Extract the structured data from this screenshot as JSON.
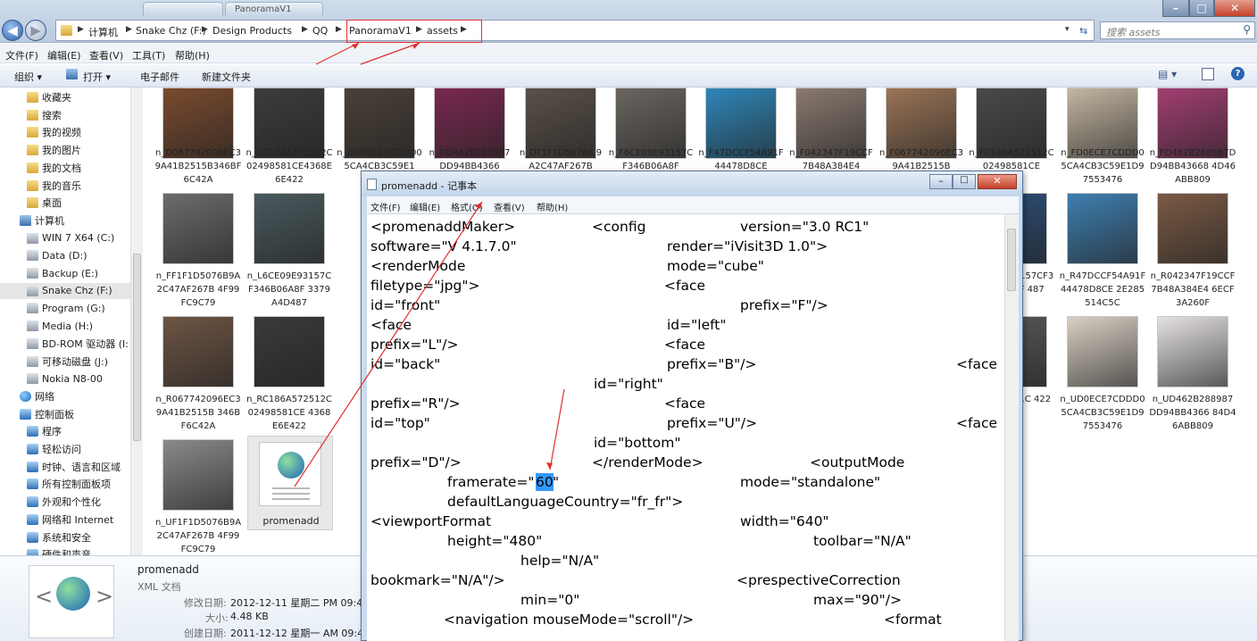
{
  "window": {
    "tabs": [
      "",
      "PanoramaV1"
    ],
    "controls": {
      "minimize": "–",
      "maximize": "□",
      "close": "✕"
    }
  },
  "address": {
    "crumbs": [
      "计算机",
      "Snake Chz (F:)",
      "Design Products",
      "QQ",
      "PanoramaV1",
      "assets"
    ],
    "search_placeholder": "搜索 assets"
  },
  "menu": [
    "文件(F)",
    "编辑(E)",
    "查看(V)",
    "工具(T)",
    "帮助(H)"
  ],
  "toolbar": {
    "organize": "组织 ▾",
    "open": "打开 ▾",
    "email": "电子邮件",
    "new_folder": "新建文件夹"
  },
  "sidebar": {
    "items": [
      {
        "label": "收藏夹",
        "icon": "folder-icon"
      },
      {
        "label": "搜索",
        "icon": "folder-icon"
      },
      {
        "label": "我的视频",
        "icon": "folder-icon"
      },
      {
        "label": "我的图片",
        "icon": "folder-icon"
      },
      {
        "label": "我的文档",
        "icon": "folder-icon"
      },
      {
        "label": "我的音乐",
        "icon": "folder-icon"
      },
      {
        "label": "桌面",
        "icon": "folder-icon"
      },
      {
        "label": "计算机",
        "icon": "computer-icon"
      },
      {
        "label": "WIN 7 X64 (C:)",
        "icon": "drive-icon"
      },
      {
        "label": "Data (D:)",
        "icon": "drive-icon"
      },
      {
        "label": "Backup (E:)",
        "icon": "drive-icon"
      },
      {
        "label": "Snake Chz (F:)",
        "icon": "drive-icon"
      },
      {
        "label": "Program (G:)",
        "icon": "drive-icon"
      },
      {
        "label": "Media (H:)",
        "icon": "drive-icon"
      },
      {
        "label": "BD-ROM 驱动器 (I:",
        "icon": "drive-icon"
      },
      {
        "label": "可移动磁盘 (J:)",
        "icon": "drive-icon"
      },
      {
        "label": "Nokia N8-00",
        "icon": "drive-icon"
      },
      {
        "label": "网络",
        "icon": "globe-icon"
      },
      {
        "label": "控制面板",
        "icon": "panel-icon"
      },
      {
        "label": "程序",
        "icon": "panel-icon"
      },
      {
        "label": "轻松访问",
        "icon": "panel-icon"
      },
      {
        "label": "时钟、语言和区域",
        "icon": "panel-icon"
      },
      {
        "label": "所有控制面板项",
        "icon": "panel-icon"
      },
      {
        "label": "外观和个性化",
        "icon": "panel-icon"
      },
      {
        "label": "网络和 Internet",
        "icon": "panel-icon"
      },
      {
        "label": "系统和安全",
        "icon": "panel-icon"
      },
      {
        "label": "硬件和声音",
        "icon": "panel-icon"
      }
    ]
  },
  "files": {
    "row1": [
      {
        "name": "n_D067742096EC39A41B2515B346BF6C42A",
        "color": "#7a4a2e"
      },
      {
        "name": "n_DC186A572512C02498581CE4368E6E422",
        "color": "#3c3c3c"
      },
      {
        "name": "n_DD0ECE7CDDD05CA4CB3C59E1",
        "color": "#4a4038"
      },
      {
        "name": "n_DD462B288987DD94BB4366",
        "color": "#7a2850"
      },
      {
        "name": "n_DF1F1D50768 9A2C47AF267B",
        "color": "#5a5048"
      },
      {
        "name": "n_F6CE09E93157CF346B06A8F",
        "color": "#6a6560"
      },
      {
        "name": "n_F47DCCF54A91F44478D8CE",
        "color": "#2f86b8"
      },
      {
        "name": "n_F042347F19CCF7B48A384E4",
        "color": "#8a7a70"
      },
      {
        "name": "n_F067742096EC39A41B2515B",
        "color": "#9a7456"
      },
      {
        "name": "n_FC186A572512C02498581CE",
        "color": "#4a4a4a"
      },
      {
        "name": "n_FD0ECE7CDDD05CA4CB3C59E1D97553476",
        "color": "#c3b6a2"
      },
      {
        "name": "n_FD462B288987DD94BB43668 4D46ABB809",
        "color": "#a23e72"
      }
    ],
    "row2": [
      {
        "name": "n_FF1F1D5076B9A2C47AF267B 4F99FC9C79",
        "color": "#6c6c6c"
      },
      {
        "name": "n_L6CE09E93157CF346B06A8F 3379A4D487",
        "color": "#4a5a5e"
      },
      {
        "name": "n_RE09E93157CF346B06A8F 487",
        "color": "#2d4f7a"
      },
      {
        "name": "n_R47DCCF54A91F44478D8CE 2E285514C5C",
        "color": "#3e7fb0"
      },
      {
        "name": "n_R042347F19CCF7B48A384E4 6ECF3A260F",
        "color": "#7a5a44"
      }
    ],
    "row3": [
      {
        "name": "n_R067742096EC39A41B2515B 346BF6C42A",
        "color": "#6e5544"
      },
      {
        "name": "n_RC186A572512C02498581CE 4368E6E422",
        "color": "#3a3a3a"
      },
      {
        "name": "n_5725 581C 422",
        "color": "#5a5a5a"
      },
      {
        "name": "n_UD0ECE7CDDD05CA4CB3C59E1D97553476",
        "color": "#d9d0c4"
      },
      {
        "name": "n_UD462B288987DD94BB4366 84D46ABB809",
        "color": "#e6e2e2"
      }
    ],
    "row4": [
      {
        "name": "n_UF1F1D5076B9A2C47AF267B 4F99FC9C79",
        "color": "#8a8a8a"
      },
      {
        "name": "promenadd",
        "color": "#ffffff"
      }
    ]
  },
  "details": {
    "name": "promenadd",
    "type": "XML 文档",
    "modified_label": "修改日期:",
    "modified": "2012-12-11 星期二 PM 09:4",
    "size_label": "大小:",
    "size": "4.48 KB",
    "created_label": "创建日期:",
    "created": "2011-12-12 星期一 AM 09:4"
  },
  "notepad": {
    "title": "promenadd - 记事本",
    "menu": [
      "文件(F)",
      "编辑(E)",
      "格式(O)",
      "查看(V)",
      "帮助(H)"
    ],
    "lines": [
      [
        "<promenaddMaker>",
        "<config",
        "version=\"3.0 RC1\""
      ],
      [
        "software=\"V 4.1.7.0\"",
        "render=\"iVisit3D 1.0\">"
      ],
      [
        "<renderMode",
        "mode=\"cube\""
      ],
      [
        "filetype=\"jpg\">",
        "<face"
      ],
      [
        "id=\"front\"",
        "prefix=\"F\"/>"
      ],
      [
        "<face",
        "id=\"left\""
      ],
      [
        "prefix=\"L\"/>",
        "<face"
      ],
      [
        "id=\"back\"",
        "prefix=\"B\"/>",
        "<face"
      ],
      [
        "id=\"right\""
      ],
      [
        "prefix=\"R\"/>",
        "<face"
      ],
      [
        "id=\"top\"",
        "prefix=\"U\"/>",
        "<face"
      ],
      [
        "id=\"bottom\""
      ],
      [
        "prefix=\"D\"/>",
        "</renderMode>",
        "<outputMode"
      ],
      [
        "framerate=\"",
        "60",
        "\"",
        "mode=\"standalone\""
      ],
      [
        "defaultLanguageCountry=\"fr_fr\">"
      ],
      [
        "<viewportFormat",
        "width=\"640\""
      ],
      [
        "height=\"480\"",
        "toolbar=\"N/A\""
      ],
      [
        "help=\"N/A\""
      ],
      [
        "bookmark=\"N/A\"/>",
        "<prespectiveCorrection"
      ],
      [
        "min=\"0\"",
        "max=\"90\"/>"
      ],
      [
        "<navigation mouseMode=\"scroll\"/>",
        "<format"
      ]
    ]
  },
  "colors": {
    "annotation": "#e0302b",
    "highlight": "#3399ff"
  }
}
